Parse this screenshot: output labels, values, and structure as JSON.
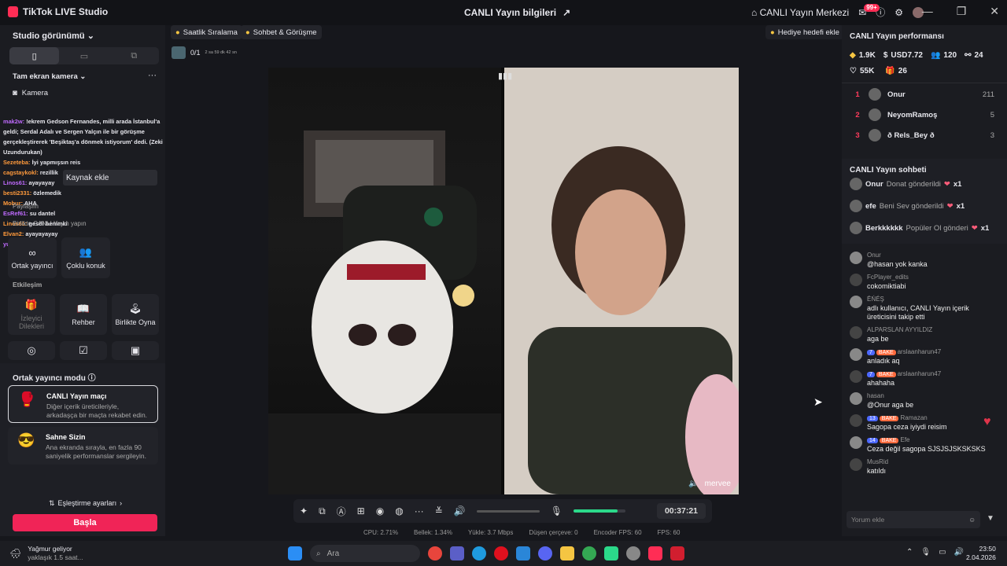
{
  "titlebar": {
    "app_name": "TikTok LIVE Studio",
    "center_title": "CANLI Yayın bilgileri",
    "center_title_icon": "share-icon",
    "center_label": "CANLI Yayın Merkezi",
    "notif_count": "99+",
    "window_controls": [
      "—",
      "❐",
      "✕"
    ]
  },
  "left": {
    "studio_view": "Studio görünümü",
    "camera_heading": "Tam ekran kamera",
    "camera_item": "Kamera",
    "add_source_tooltip": "Kaynak ekle",
    "overlay_chat": [
      {
        "user": "mak2w:",
        "text": "!ekrem Gedson Fernandes, milli arada İstanbul'a"
      },
      {
        "user": "",
        "text": "geldi; Serdal Adalı ve Sergen Yalçın ile bir görüşme"
      },
      {
        "user": "",
        "text": "gerçekleştirerek 'Beşiktaş'a dönmek istiyorum' dedi. (Zeki"
      },
      {
        "user": "",
        "text": "Uzundurukan)"
      },
      {
        "user": "Sezeteba:",
        "text": "İyi yapmışsın reis"
      },
      {
        "user": "cagstaykokl:",
        "text": "rezillik"
      },
      {
        "user": "Linos61:",
        "text": "ayayayay"
      },
      {
        "user": "besti2331:",
        "text": "özlemedik"
      },
      {
        "user": "Mobur:",
        "text": "AHA"
      },
      {
        "user": "EsRef61:",
        "text": "su dantel"
      },
      {
        "user": "Linos61:",
        "text": "gesdi benimki"
      },
      {
        "user": "Elvan2:",
        "text": "ayayayayay"
      },
      {
        "user": "yusuffoo:",
        "text": "auvvvv"
      }
    ],
    "overlay_misc": [
      "Paylaşım",
      "Birlikte CANLI Yayın yapın"
    ],
    "tiles_row1": [
      {
        "label": "Ortak yayıncı",
        "icon": "link-icon"
      },
      {
        "label": "Çoklu konuk",
        "icon": "users-icon"
      }
    ],
    "interaction_heading": "Etkileşim",
    "tiles_row2": [
      {
        "label": "İzleyici Dilekleri",
        "icon": "gift-icon"
      },
      {
        "label": "Rehber",
        "icon": "book-icon"
      },
      {
        "label": "Birlikte Oyna",
        "icon": "joystick-icon"
      }
    ],
    "cohost_heading": "Ortak yayıncı modu",
    "modes": [
      {
        "title": "CANLI Yayın maçı",
        "desc": "Diğer içerik üreticileriyle, arkadaşça bir maçta rekabet edin.",
        "emoji": "🥊"
      },
      {
        "title": "Sahne Sizin",
        "desc": "Ana ekranda sırayla, en fazla 90 saniyelik performanslar sergileyin.",
        "emoji": "😎"
      }
    ],
    "match_settings": "Eşleştirme ayarları",
    "start_button": "Başla"
  },
  "center": {
    "chip1": "Saatlik Sıralama",
    "chip2": "Sohbet & Görüşme",
    "goal_count": "0/1",
    "goal_timer": "2 sa 59 dk 42 sn",
    "gift_goal": "Hediye hedefi ekle",
    "guest_name": "mervee",
    "timer": "00:37:21",
    "volume_fraction": 0.85
  },
  "stats": {
    "cpu": "CPU: 2.71%",
    "memory": "Bellek: 1.34%",
    "upload": "Yükle: 3.7 Mbps",
    "dropped": "Düşen çerçeve: 0",
    "encoder_fps": "Encoder FPS: 60",
    "fps": "FPS: 60"
  },
  "right": {
    "perf_heading": "CANLI Yayın performansı",
    "diamonds": "1.9K",
    "usd": "USD7.72",
    "viewers": "120",
    "followers": "24",
    "likes": "55K",
    "gifters": "26",
    "ranking": [
      {
        "rank": "1",
        "name": "Onur",
        "score": "211"
      },
      {
        "rank": "2",
        "name": "NeyomRamoş",
        "score": "5"
      },
      {
        "rank": "3",
        "name": "ð Rels_Bey ð",
        "score": "3"
      }
    ],
    "chat_heading": "CANLI Yayın sohbeti",
    "gifts": [
      {
        "name": "Onur",
        "action": "Donat gönderildi",
        "count": "x1"
      },
      {
        "name": "efe",
        "action": "Beni Sev gönderildi",
        "count": "x1"
      },
      {
        "name": "Berkkkkkk",
        "action": "Popüler Ol gönderi",
        "count": "x1"
      }
    ],
    "comments": [
      {
        "name": "Onur",
        "level": "",
        "team": "",
        "text": "@hasan yok kanka"
      },
      {
        "name": "FcPlayer_edits",
        "level": "",
        "team": "",
        "text": "cokomiktiabi"
      },
      {
        "name": "ĒŃÉŞ",
        "level": "",
        "team": "",
        "text": "adlı kullanıcı, CANLI Yayın içerik üreticisini takip etti"
      },
      {
        "name": "ALPARSLAN AYYILDIZ",
        "level": "",
        "team": "",
        "text": "aga be"
      },
      {
        "name": "arslaanharun47",
        "level": "7",
        "team": "BAKE",
        "text": "anladık aq"
      },
      {
        "name": "arslaanharun47",
        "level": "7",
        "team": "BAKE",
        "text": "ahahaha"
      },
      {
        "name": "hasan",
        "level": "",
        "team": "",
        "text": "@Onur aga be"
      },
      {
        "name": "Ramazan",
        "level": "13",
        "team": "BAKE",
        "text": "Sagopa ceza iyiydi reisim"
      },
      {
        "name": "Efe",
        "level": "14",
        "team": "BAKE",
        "text": "Ceza değil sagopa SJSJSJSKSKSKS"
      },
      {
        "name": "MusRid",
        "level": "",
        "team": "",
        "text": "katıldı"
      }
    ],
    "comment_placeholder": "Yorum ekle"
  },
  "taskbar": {
    "weather_title": "Yağmur geliyor",
    "weather_sub": "yaklaşık 1.5 saat...",
    "search": "Ara",
    "time": "23:50",
    "date": "2.04.2026"
  }
}
